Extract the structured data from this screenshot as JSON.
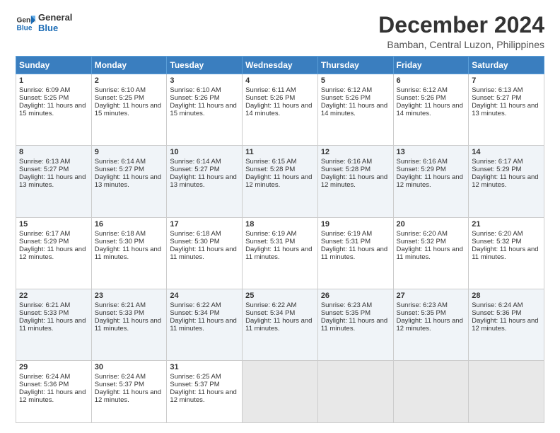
{
  "logo": {
    "line1": "General",
    "line2": "Blue"
  },
  "title": "December 2024",
  "subtitle": "Bamban, Central Luzon, Philippines",
  "headers": [
    "Sunday",
    "Monday",
    "Tuesday",
    "Wednesday",
    "Thursday",
    "Friday",
    "Saturday"
  ],
  "weeks": [
    [
      {
        "day": "1",
        "sunrise": "6:09 AM",
        "sunset": "5:25 PM",
        "daylight": "11 hours and 15 minutes."
      },
      {
        "day": "2",
        "sunrise": "6:10 AM",
        "sunset": "5:25 PM",
        "daylight": "11 hours and 15 minutes."
      },
      {
        "day": "3",
        "sunrise": "6:10 AM",
        "sunset": "5:26 PM",
        "daylight": "11 hours and 15 minutes."
      },
      {
        "day": "4",
        "sunrise": "6:11 AM",
        "sunset": "5:26 PM",
        "daylight": "11 hours and 14 minutes."
      },
      {
        "day": "5",
        "sunrise": "6:12 AM",
        "sunset": "5:26 PM",
        "daylight": "11 hours and 14 minutes."
      },
      {
        "day": "6",
        "sunrise": "6:12 AM",
        "sunset": "5:26 PM",
        "daylight": "11 hours and 14 minutes."
      },
      {
        "day": "7",
        "sunrise": "6:13 AM",
        "sunset": "5:27 PM",
        "daylight": "11 hours and 13 minutes."
      }
    ],
    [
      {
        "day": "8",
        "sunrise": "6:13 AM",
        "sunset": "5:27 PM",
        "daylight": "11 hours and 13 minutes."
      },
      {
        "day": "9",
        "sunrise": "6:14 AM",
        "sunset": "5:27 PM",
        "daylight": "11 hours and 13 minutes."
      },
      {
        "day": "10",
        "sunrise": "6:14 AM",
        "sunset": "5:27 PM",
        "daylight": "11 hours and 13 minutes."
      },
      {
        "day": "11",
        "sunrise": "6:15 AM",
        "sunset": "5:28 PM",
        "daylight": "11 hours and 12 minutes."
      },
      {
        "day": "12",
        "sunrise": "6:16 AM",
        "sunset": "5:28 PM",
        "daylight": "11 hours and 12 minutes."
      },
      {
        "day": "13",
        "sunrise": "6:16 AM",
        "sunset": "5:29 PM",
        "daylight": "11 hours and 12 minutes."
      },
      {
        "day": "14",
        "sunrise": "6:17 AM",
        "sunset": "5:29 PM",
        "daylight": "11 hours and 12 minutes."
      }
    ],
    [
      {
        "day": "15",
        "sunrise": "6:17 AM",
        "sunset": "5:29 PM",
        "daylight": "11 hours and 12 minutes."
      },
      {
        "day": "16",
        "sunrise": "6:18 AM",
        "sunset": "5:30 PM",
        "daylight": "11 hours and 11 minutes."
      },
      {
        "day": "17",
        "sunrise": "6:18 AM",
        "sunset": "5:30 PM",
        "daylight": "11 hours and 11 minutes."
      },
      {
        "day": "18",
        "sunrise": "6:19 AM",
        "sunset": "5:31 PM",
        "daylight": "11 hours and 11 minutes."
      },
      {
        "day": "19",
        "sunrise": "6:19 AM",
        "sunset": "5:31 PM",
        "daylight": "11 hours and 11 minutes."
      },
      {
        "day": "20",
        "sunrise": "6:20 AM",
        "sunset": "5:32 PM",
        "daylight": "11 hours and 11 minutes."
      },
      {
        "day": "21",
        "sunrise": "6:20 AM",
        "sunset": "5:32 PM",
        "daylight": "11 hours and 11 minutes."
      }
    ],
    [
      {
        "day": "22",
        "sunrise": "6:21 AM",
        "sunset": "5:33 PM",
        "daylight": "11 hours and 11 minutes."
      },
      {
        "day": "23",
        "sunrise": "6:21 AM",
        "sunset": "5:33 PM",
        "daylight": "11 hours and 11 minutes."
      },
      {
        "day": "24",
        "sunrise": "6:22 AM",
        "sunset": "5:34 PM",
        "daylight": "11 hours and 11 minutes."
      },
      {
        "day": "25",
        "sunrise": "6:22 AM",
        "sunset": "5:34 PM",
        "daylight": "11 hours and 11 minutes."
      },
      {
        "day": "26",
        "sunrise": "6:23 AM",
        "sunset": "5:35 PM",
        "daylight": "11 hours and 11 minutes."
      },
      {
        "day": "27",
        "sunrise": "6:23 AM",
        "sunset": "5:35 PM",
        "daylight": "11 hours and 12 minutes."
      },
      {
        "day": "28",
        "sunrise": "6:24 AM",
        "sunset": "5:36 PM",
        "daylight": "11 hours and 12 minutes."
      }
    ],
    [
      {
        "day": "29",
        "sunrise": "6:24 AM",
        "sunset": "5:36 PM",
        "daylight": "11 hours and 12 minutes."
      },
      {
        "day": "30",
        "sunrise": "6:24 AM",
        "sunset": "5:37 PM",
        "daylight": "11 hours and 12 minutes."
      },
      {
        "day": "31",
        "sunrise": "6:25 AM",
        "sunset": "5:37 PM",
        "daylight": "11 hours and 12 minutes."
      },
      null,
      null,
      null,
      null
    ]
  ]
}
